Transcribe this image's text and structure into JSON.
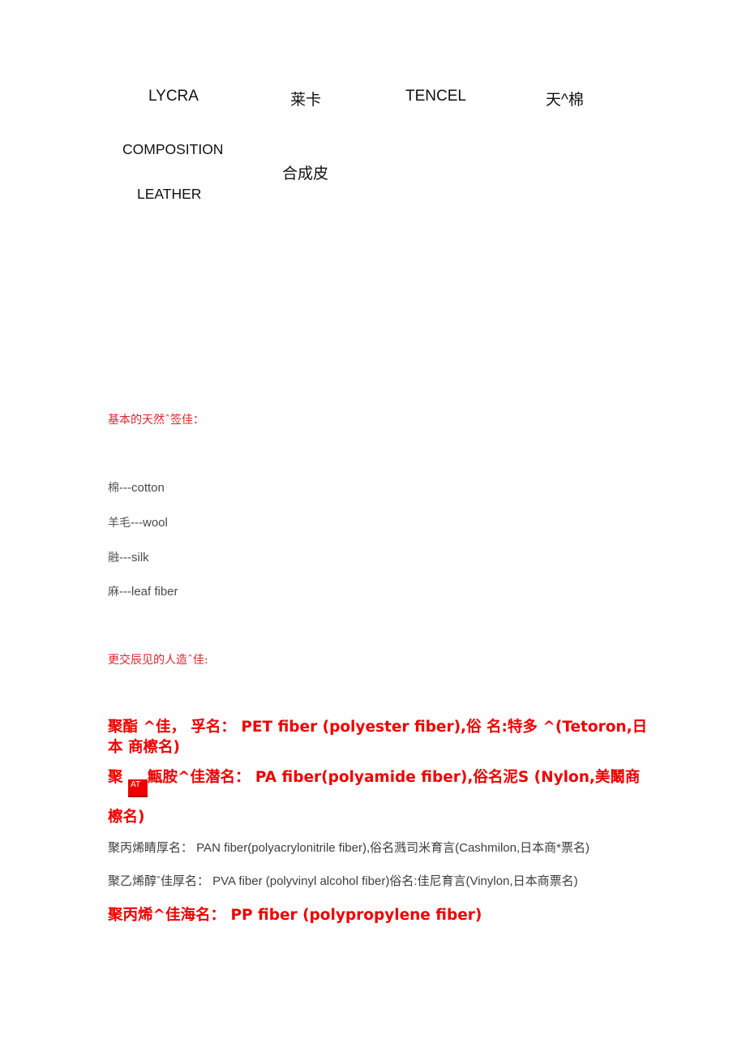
{
  "terms_row1": [
    {
      "text": "LYCRA"
    },
    {
      "text": "莱卡"
    },
    {
      "text": "TENCEL"
    },
    {
      "text": "天^棉"
    }
  ],
  "terms_row2": {
    "composition_line1": "COMPOSITION",
    "composition_line2": "LEATHER",
    "composition_zh": "合成皮"
  },
  "natural_section": {
    "heading": "基本的天然ˆ签佳：",
    "items": [
      {
        "zh": "棉",
        "en": "---cotton"
      },
      {
        "zh": "羊毛",
        "en": "---wool"
      },
      {
        "zh": "融",
        "en": "---silk"
      },
      {
        "zh": "麻",
        "en": "---leaf fiber"
      }
    ]
  },
  "manmade_section": {
    "heading": "更交辰见的人造ˆ佳:",
    "pet": {
      "line1": "聚酯 ^佳， 孚名： PET fiber (polyester fiber),俗 名:特多 ^(Tetoron,日",
      "line2": "本  商檫名)"
    },
    "pa": {
      "prefix": "聚 ",
      "badge": "AT",
      "line1_rest": "甒胺^佳潜名： PA fiber(polyamide fiber),俗名泥S (Nylon,美鬫商",
      "line2": "檫名)"
    },
    "pan": "聚丙烯睛厚名： PAN fiber(polyacrylonitrile fiber),俗名溅司米育言(Cashmilon,日本商*票名)",
    "pva": "聚乙烯醇ˆ佳厚名： PVA fiber (polyvinyl alcohol fiber)俗名:佳尼育言(Vinylon,日本商票名)",
    "pp": "聚丙烯^佳海名： PP fiber (polypropylene fiber)"
  },
  "colors": {
    "heading_red": "#d9262b",
    "bold_red": "#ee0000",
    "body_gray": "#4a4a4a"
  }
}
